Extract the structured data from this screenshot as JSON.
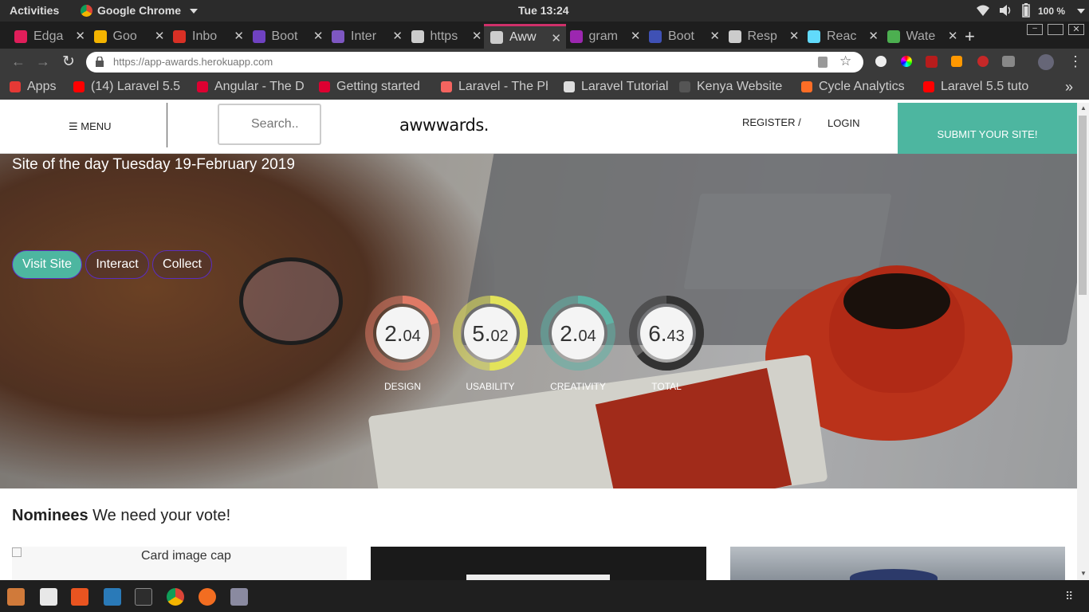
{
  "os": {
    "activities": "Activities",
    "app_name": "Google Chrome",
    "clock": "Tue 13:24",
    "battery": "100 %"
  },
  "tabs": [
    {
      "label": "Edga",
      "color": "#e01e5a"
    },
    {
      "label": "Goo",
      "color": "#f4b400"
    },
    {
      "label": "Inbo",
      "color": "#d93025"
    },
    {
      "label": "Boot",
      "color": "#6f42c1"
    },
    {
      "label": "Inter",
      "color": "#7e57c2"
    },
    {
      "label": "https",
      "color": "#cccccc"
    },
    {
      "label": "Aww",
      "color": "#cccccc"
    },
    {
      "label": "gram",
      "color": "#9c27b0"
    },
    {
      "label": "Boot",
      "color": "#3f51b5"
    },
    {
      "label": "Resp",
      "color": "#cccccc"
    },
    {
      "label": "Reac",
      "color": "#61dafb"
    },
    {
      "label": "Wate",
      "color": "#4caf50"
    }
  ],
  "address": {
    "url": "https://app-awards.herokuapp.com"
  },
  "bookmarks": [
    {
      "label": "Apps",
      "color": "#e53935"
    },
    {
      "label": "(14) Laravel 5.5",
      "color": "#ff0000"
    },
    {
      "label": "Angular - The D",
      "color": "#dd0031"
    },
    {
      "label": "Getting started",
      "color": "#dd0031"
    },
    {
      "label": "Laravel - The Ph",
      "color": "#f4645f"
    },
    {
      "label": "Laravel Tutorial",
      "color": "#dddddd"
    },
    {
      "label": "Kenya Website D",
      "color": "#555555"
    },
    {
      "label": "Cycle Analytics",
      "color": "#fc6d26"
    },
    {
      "label": "Laravel 5.5 tuto",
      "color": "#ff0000"
    }
  ],
  "bookmarks_more": "»",
  "nav": {
    "menu": "☰ MENU",
    "search_placeholder": "Search..",
    "logo": "awwwards.",
    "register": "REGISTER /",
    "login": "LOGIN",
    "submit": "SUBMIT YOUR SITE!"
  },
  "hero": {
    "site_of_day": "Site of the day Tuesday 19-February 2019",
    "visit": "Visit Site",
    "interact": "Interact",
    "collect": "Collect"
  },
  "scores": [
    {
      "label": "DESIGN",
      "int": "2.",
      "dec": "04",
      "value": 2.04,
      "color": "#e07a66"
    },
    {
      "label": "USABILITY",
      "int": "5.",
      "dec": "02",
      "value": 5.02,
      "color": "#e3e35a"
    },
    {
      "label": "CREATIVITY",
      "int": "2.",
      "dec": "04",
      "value": 2.04,
      "color": "#5fb3a5"
    },
    {
      "label": "TOTAL",
      "int": "6.",
      "dec": "43",
      "value": 6.43,
      "color": "#333333"
    }
  ],
  "nominees": {
    "bold": "Nominees",
    "rest": "We need your vote!",
    "card_alt": "Card image cap"
  },
  "colors": {
    "accent": "#4db6a0",
    "purple": "#5a2dc0"
  }
}
